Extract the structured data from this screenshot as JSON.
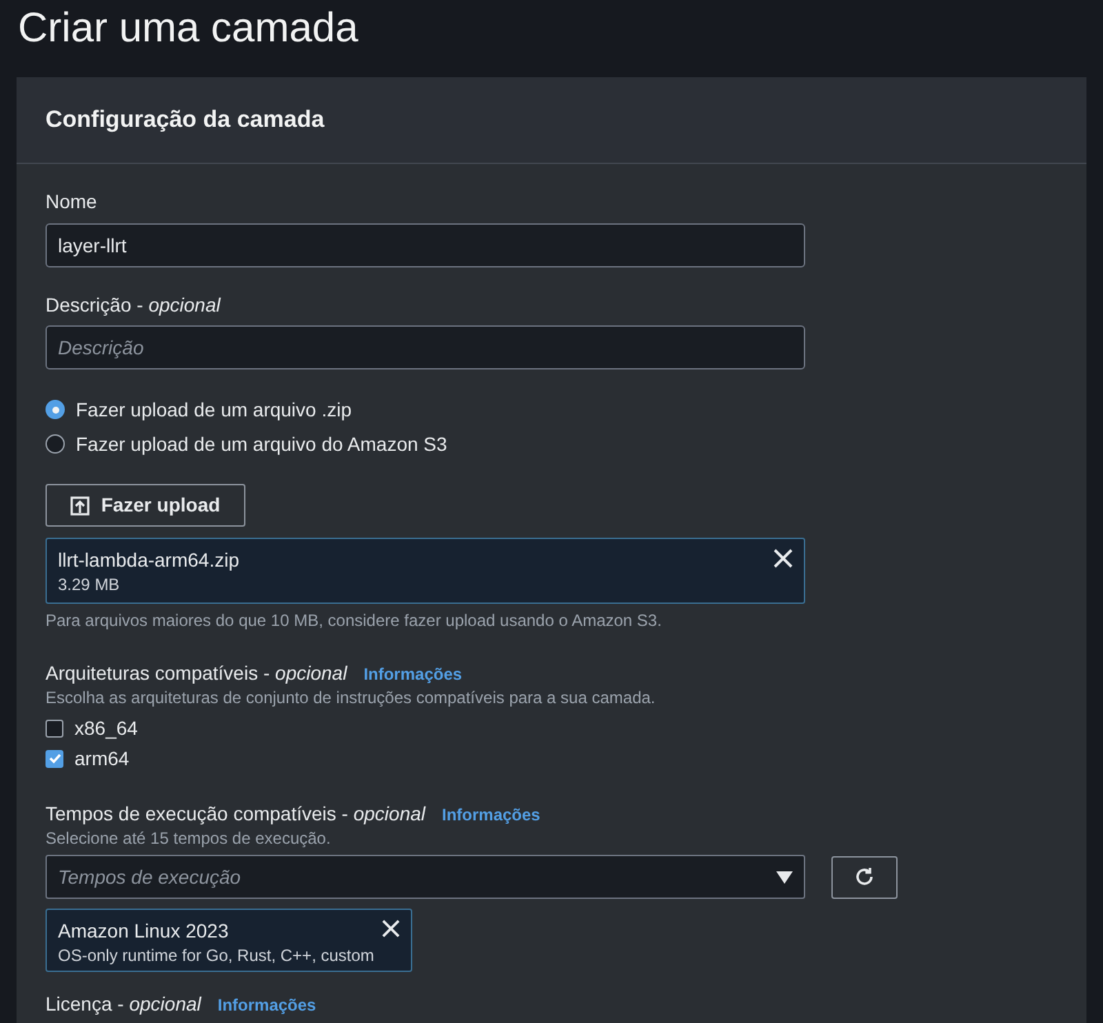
{
  "page_title": "Criar uma camada",
  "panel": {
    "heading": "Configuração da camada"
  },
  "name_field": {
    "label": "Nome",
    "value": "layer-llrt"
  },
  "description_field": {
    "label": "Descrição",
    "separator": "-",
    "optional": "opcional",
    "placeholder": "Descrição"
  },
  "upload_source": [
    {
      "label": "Fazer upload de um arquivo .zip",
      "selected": true
    },
    {
      "label": "Fazer upload de um arquivo do Amazon S3",
      "selected": false
    }
  ],
  "upload_button": "Fazer upload",
  "file": {
    "name": "llrt-lambda-arm64.zip",
    "size": "3.29 MB"
  },
  "upload_hint": "Para arquivos maiores do que 10 MB, considere fazer upload usando o Amazon S3.",
  "architectures": {
    "label": "Arquiteturas compatíveis",
    "separator": "-",
    "optional": "opcional",
    "info": "Informações",
    "description": "Escolha as arquiteturas de conjunto de instruções compatíveis para a sua camada.",
    "options": [
      {
        "label": "x86_64",
        "checked": false
      },
      {
        "label": "arm64",
        "checked": true
      }
    ]
  },
  "runtimes": {
    "label": "Tempos de execução compatíveis",
    "separator": "-",
    "optional": "opcional",
    "info": "Informações",
    "description": "Selecione até 15 tempos de execução.",
    "placeholder": "Tempos de execução",
    "tokens": [
      {
        "title": "Amazon Linux 2023",
        "description": "OS-only runtime for Go, Rust, C++, custom"
      }
    ]
  },
  "license": {
    "label": "Licença",
    "separator": "-",
    "optional": "opcional",
    "info": "Informações"
  }
}
